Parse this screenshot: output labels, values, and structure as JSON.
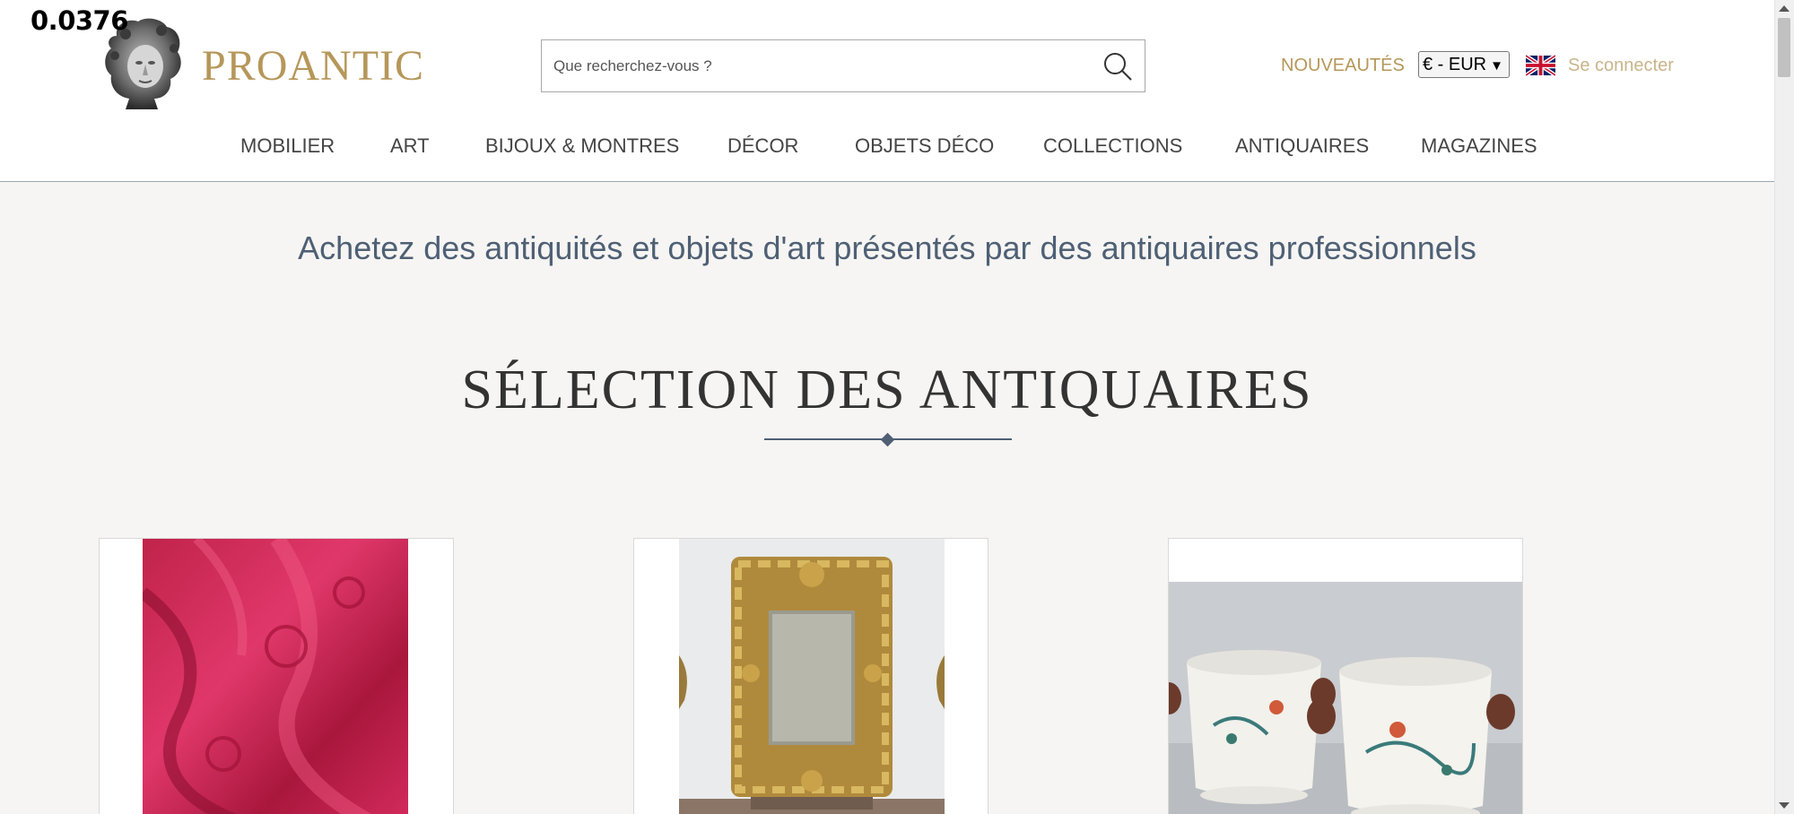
{
  "overlay": {
    "value": "0.0376"
  },
  "brand": {
    "name": "PROANTIC"
  },
  "search": {
    "placeholder": "Que recherchez-vous ?",
    "icon": "search-icon"
  },
  "topbar": {
    "new_label": "NOUVEAUTÉS",
    "currency": "€ - EUR",
    "language_icon": "uk-flag-icon",
    "login_label": "Se connecter"
  },
  "nav": {
    "items": [
      "MOBILIER",
      "ART",
      "BIJOUX & MONTRES",
      "DÉCOR",
      "OBJETS DÉCO",
      "COLLECTIONS",
      "ANTIQUAIRES",
      "MAGAZINES"
    ]
  },
  "hero": {
    "tagline": "Achetez des antiquités et objets d'art présentés par des antiquaires professionnels"
  },
  "selection": {
    "title": "SÉLECTION DES ANTIQUAIRES"
  },
  "colors": {
    "gold": "#b6975a",
    "slate": "#4f6075",
    "background": "#f6f5f3"
  }
}
